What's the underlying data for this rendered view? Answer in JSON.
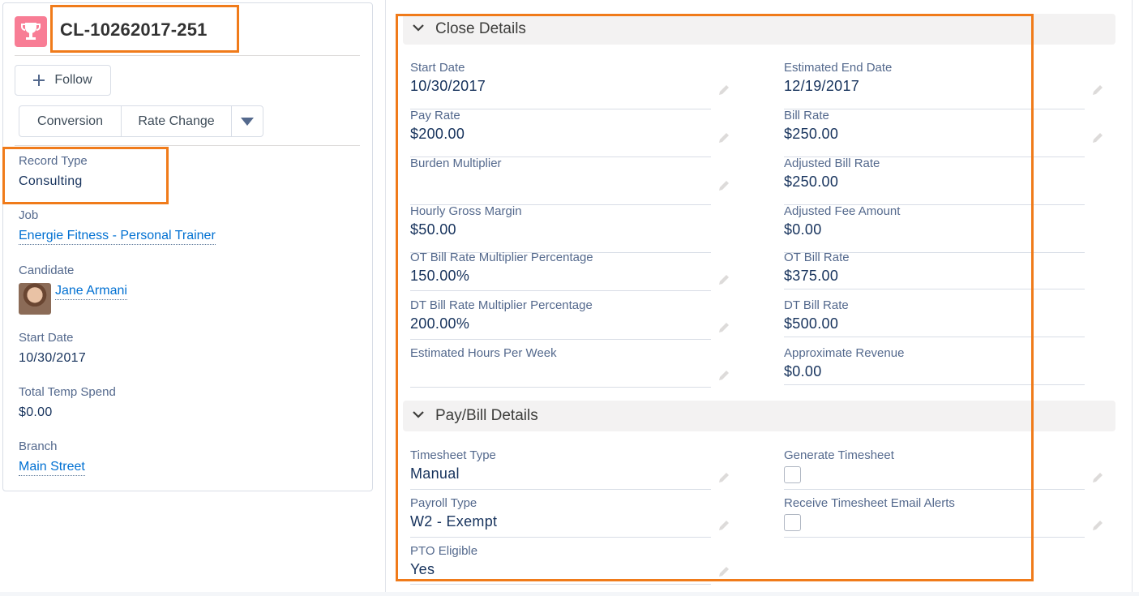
{
  "record": {
    "title": "CL-10262017-251",
    "icon": "trophy-icon",
    "icon_color": "#f87d95"
  },
  "actions": {
    "follow": "Follow",
    "conversion": "Conversion",
    "rate_change": "Rate Change"
  },
  "highlights": {
    "fields": [
      {
        "label": "Record Type",
        "value": "Consulting"
      },
      {
        "label": "Job",
        "value": "Energie Fitness - Personal Trainer"
      },
      {
        "label": "Candidate",
        "value": "Jane Armani"
      },
      {
        "label": "Start Date",
        "value": "10/30/2017"
      },
      {
        "label": "Total Temp Spend",
        "value": "$0.00"
      },
      {
        "label": "Branch",
        "value": "Main Street"
      }
    ]
  },
  "sections": [
    {
      "title": "Close Details",
      "fields": [
        {
          "label": "Start Date",
          "value": "10/30/2017"
        },
        {
          "label": "Estimated End Date",
          "value": "12/19/2017"
        },
        {
          "label": "Pay Rate",
          "value": "$200.00"
        },
        {
          "label": "Bill Rate",
          "value": "$250.00"
        },
        {
          "label": "Burden Multiplier",
          "value": ""
        },
        {
          "label": "Adjusted Bill Rate",
          "value": "$250.00"
        },
        {
          "label": "Hourly Gross Margin",
          "value": "$50.00"
        },
        {
          "label": "Adjusted Fee Amount",
          "value": "$0.00"
        },
        {
          "label": "OT Bill Rate Multiplier Percentage",
          "value": "150.00%"
        },
        {
          "label": "OT Bill Rate",
          "value": "$375.00"
        },
        {
          "label": "DT Bill Rate Multiplier Percentage",
          "value": "200.00%"
        },
        {
          "label": "DT Bill Rate",
          "value": "$500.00"
        },
        {
          "label": "Estimated Hours Per Week",
          "value": ""
        },
        {
          "label": "Approximate Revenue",
          "value": "$0.00"
        }
      ]
    },
    {
      "title": "Pay/Bill Details",
      "fields": [
        {
          "label": "Timesheet Type",
          "value": "Manual"
        },
        {
          "label": "Generate Timesheet",
          "checked": false
        },
        {
          "label": "Payroll Type",
          "value": "W2 - Exempt"
        },
        {
          "label": "Receive Timesheet Email Alerts",
          "checked": false
        },
        {
          "label": "PTO Eligible",
          "value": "Yes"
        }
      ]
    }
  ],
  "colors": {
    "accent_highlight": "#f07b1a",
    "link": "#0070d2",
    "section_bg": "#f3f2f2"
  }
}
